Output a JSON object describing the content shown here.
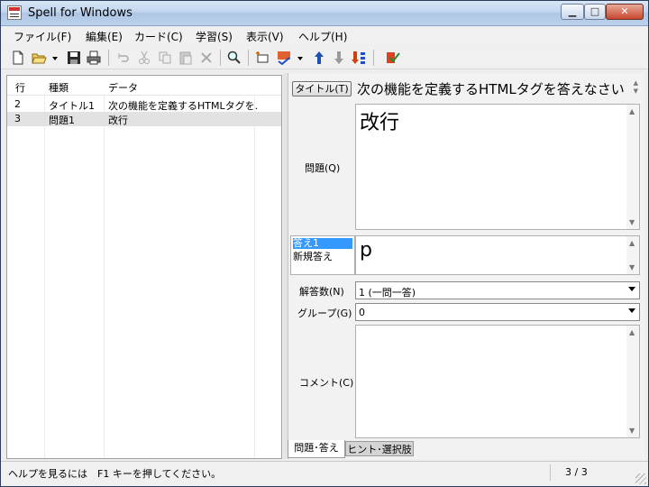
{
  "window": {
    "title": "Spell for Windows",
    "controls": {
      "minimize": "▁",
      "maximize": "□",
      "close": "✕"
    }
  },
  "menu": [
    "ファイル(F)",
    "編集(E)",
    "カード(C)",
    "学習(S)",
    "表示(V)",
    "ヘルプ(H)"
  ],
  "toolbar_icons": [
    "new-file-icon",
    "open-folder-icon",
    "dropdown-arrow-icon",
    "save-icon",
    "print-icon",
    "undo-icon",
    "cut-icon",
    "copy-icon",
    "paste-icon",
    "delete-icon",
    "find-icon",
    "new-card-icon",
    "spell-check-icon",
    "dropdown-arrow-icon",
    "move-up-icon",
    "move-down-icon",
    "sort-icon",
    "exit-icon"
  ],
  "list": {
    "headers": {
      "row": "行",
      "type": "種類",
      "data": "データ"
    },
    "rows": [
      {
        "row": "2",
        "type": "タイトル1",
        "data": "次の機能を定義するHTMLタグを..."
      },
      {
        "row": "3",
        "type": "問題1",
        "data": "改行"
      }
    ]
  },
  "editor": {
    "title_button": "タイトル(T)",
    "title_text": "次の機能を定義するHTMLタグを答えなさい",
    "question_label": "問題(Q)",
    "question_text": "改行",
    "answers": [
      "答え1",
      "新規答え"
    ],
    "answer_text": "p",
    "answer_count_label": "解答数(N)",
    "answer_count_value": "1 (一問一答)",
    "group_label": "グループ(G)",
    "group_value": "0",
    "comment_label": "コメント(C)",
    "comment_text": ""
  },
  "tabs": [
    "問題･答え",
    "ヒント･選択肢"
  ],
  "status": {
    "help": "ヘルプを見るには　F1 キーを押してください。",
    "count": "3 / 3"
  },
  "colors": {
    "selection": "#3399ff",
    "title_gradient": "#c2d6ee"
  }
}
